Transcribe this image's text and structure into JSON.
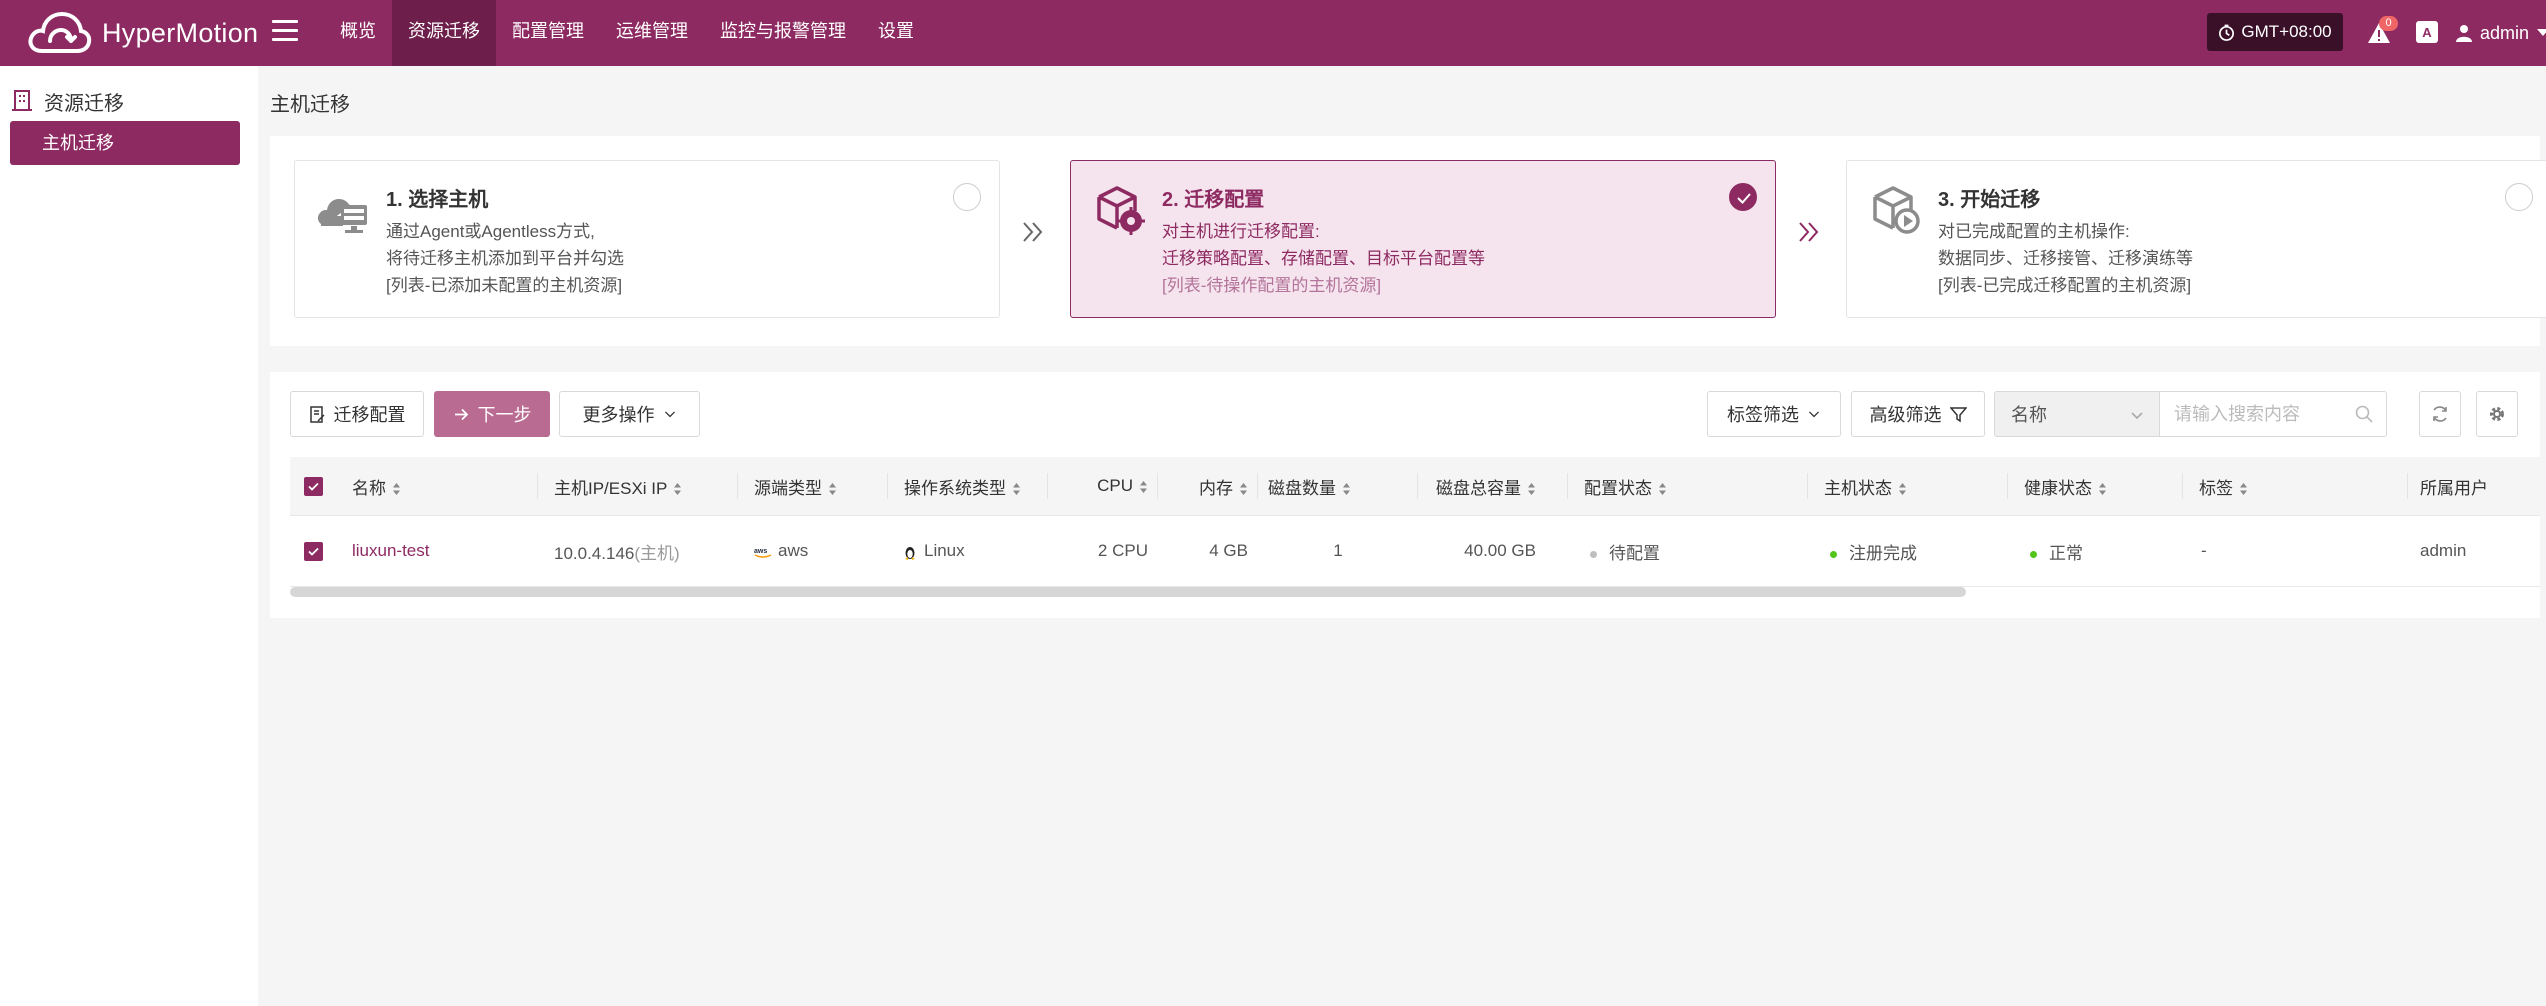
{
  "app": {
    "name": "HyperMotion"
  },
  "nav": {
    "items": [
      {
        "label": "概览"
      },
      {
        "label": "资源迁移"
      },
      {
        "label": "配置管理"
      },
      {
        "label": "运维管理"
      },
      {
        "label": "监控与报警管理"
      },
      {
        "label": "设置"
      }
    ],
    "active_index": 1
  },
  "header": {
    "timezone": "GMT+08:00",
    "alert_count": "0",
    "font_button": "A",
    "user": "admin"
  },
  "sidebar": {
    "section": "资源迁移",
    "items": [
      {
        "label": "主机迁移",
        "active": true
      }
    ]
  },
  "page": {
    "title": "主机迁移"
  },
  "steps": [
    {
      "title": "1. 选择主机",
      "lines": [
        "通过Agent或Agentless方式,",
        "将待迁移主机添加到平台并勾选",
        "[列表-已添加未配置的主机资源]"
      ],
      "icon": "cloud-server-icon",
      "selected": false
    },
    {
      "title": "2. 迁移配置",
      "lines": [
        "对主机进行迁移配置:",
        "迁移策略配置、存储配置、目标平台配置等",
        "[列表-待操作配置的主机资源]"
      ],
      "icon": "config-box-icon",
      "selected": true
    },
    {
      "title": "3. 开始迁移",
      "lines": [
        "对已完成配置的主机操作:",
        "数据同步、迁移接管、迁移演练等",
        "[列表-已完成迁移配置的主机资源]"
      ],
      "icon": "play-box-icon",
      "selected": false
    }
  ],
  "toolbar": {
    "migrate_config": "迁移配置",
    "next_step": "下一步",
    "more_actions": "更多操作",
    "tag_filter": "标签筛选",
    "advanced_filter": "高级筛选",
    "search_field": "名称",
    "search_placeholder": "请输入搜索内容"
  },
  "table": {
    "columns": [
      "名称",
      "主机IP/ESXi IP",
      "源端类型",
      "操作系统类型",
      "CPU",
      "内存",
      "磁盘数量",
      "磁盘总容量",
      "配置状态",
      "主机状态",
      "健康状态",
      "标签",
      "所属用户"
    ],
    "rows": [
      {
        "name": "liuxun-test",
        "ip": "10.0.4.146",
        "ip_note": "(主机)",
        "source": "aws",
        "os": "Linux",
        "cpu": "2 CPU",
        "memory": "4 GB",
        "disk_count": "1",
        "disk_total": "40.00 GB",
        "config_status": "待配置",
        "host_status": "注册完成",
        "health": "正常",
        "tag": "-",
        "owner": "admin"
      }
    ]
  },
  "colors": {
    "brand": "#8e2a62",
    "status_pending": "#bfbfbf",
    "status_ok": "#52c41a"
  }
}
